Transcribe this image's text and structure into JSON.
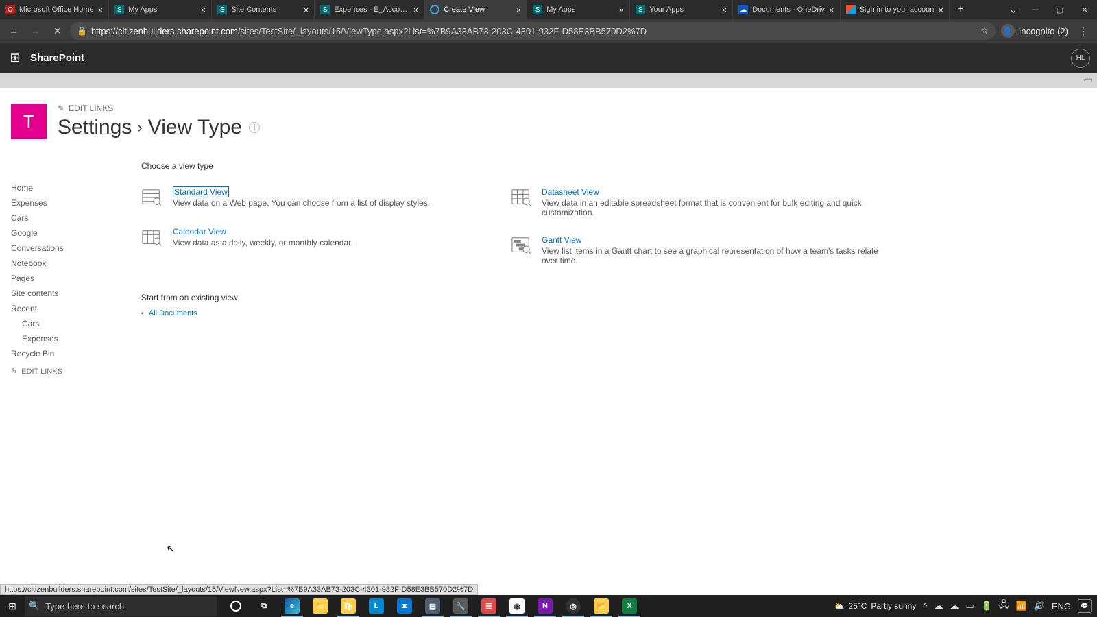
{
  "browser": {
    "tabs": [
      {
        "title": "Microsoft Office Home",
        "favicon": "fav-red",
        "active": false
      },
      {
        "title": "My Apps",
        "favicon": "fav-teal",
        "active": false
      },
      {
        "title": "Site Contents",
        "favicon": "fav-teal",
        "active": false
      },
      {
        "title": "Expenses - E_Account",
        "favicon": "fav-teal",
        "active": false
      },
      {
        "title": "Create View",
        "favicon": "fav-ring",
        "active": true
      },
      {
        "title": "My Apps",
        "favicon": "fav-teal",
        "active": false
      },
      {
        "title": "Your Apps",
        "favicon": "fav-teal",
        "active": false
      },
      {
        "title": "Documents - OneDriv",
        "favicon": "fav-cloud",
        "active": false
      },
      {
        "title": "Sign in to your accoun",
        "favicon": "fav-ms",
        "active": false
      }
    ],
    "url_host": "citizenbuilders.sharepoint.com",
    "url_path": "/sites/TestSite/_layouts/15/ViewType.aspx?List=%7B9A33AB73-203C-4301-932F-D58E3BB570D2%7D",
    "incognito_label": "Incognito (2)"
  },
  "suite": {
    "app": "SharePoint",
    "avatar": "HL"
  },
  "header": {
    "edit_links": "EDIT LINKS",
    "site_letter": "T",
    "breadcrumb": {
      "root": "Settings",
      "sep": "›",
      "current": "View Type"
    }
  },
  "nav": {
    "items": [
      "Home",
      "Expenses",
      "Cars",
      "Google",
      "Conversations",
      "Notebook",
      "Pages",
      "Site contents",
      "Recent"
    ],
    "recent_children": [
      "Cars",
      "Expenses"
    ],
    "recycle": "Recycle Bin",
    "edit_links": "EDIT LINKS"
  },
  "content": {
    "section1": "Choose a view type",
    "views": [
      {
        "title": "Standard View",
        "desc": "View data on a Web page. You can choose from a list of display styles.",
        "selected": true
      },
      {
        "title": "Datasheet View",
        "desc": "View data in an editable spreadsheet format that is convenient for bulk editing and quick customization.",
        "selected": false
      },
      {
        "title": "Calendar View",
        "desc": "View data as a daily, weekly, or monthly calendar.",
        "selected": false
      },
      {
        "title": "Gantt View",
        "desc": "View list items in a Gantt chart to see a graphical representation of how a team's tasks relate over time.",
        "selected": false
      }
    ],
    "section2": "Start from an existing view",
    "existing": "All Documents"
  },
  "hover_url": "https://citizenbuilders.sharepoint.com/sites/TestSite/_layouts/15/ViewNew.aspx?List=%7B9A33AB73-203C-4301-932F-D58E3BB570D2%7D",
  "taskbar": {
    "search_placeholder": "Type here to search",
    "weather_temp": "25°C",
    "weather_cond": "Partly sunny",
    "lang": "ENG"
  }
}
